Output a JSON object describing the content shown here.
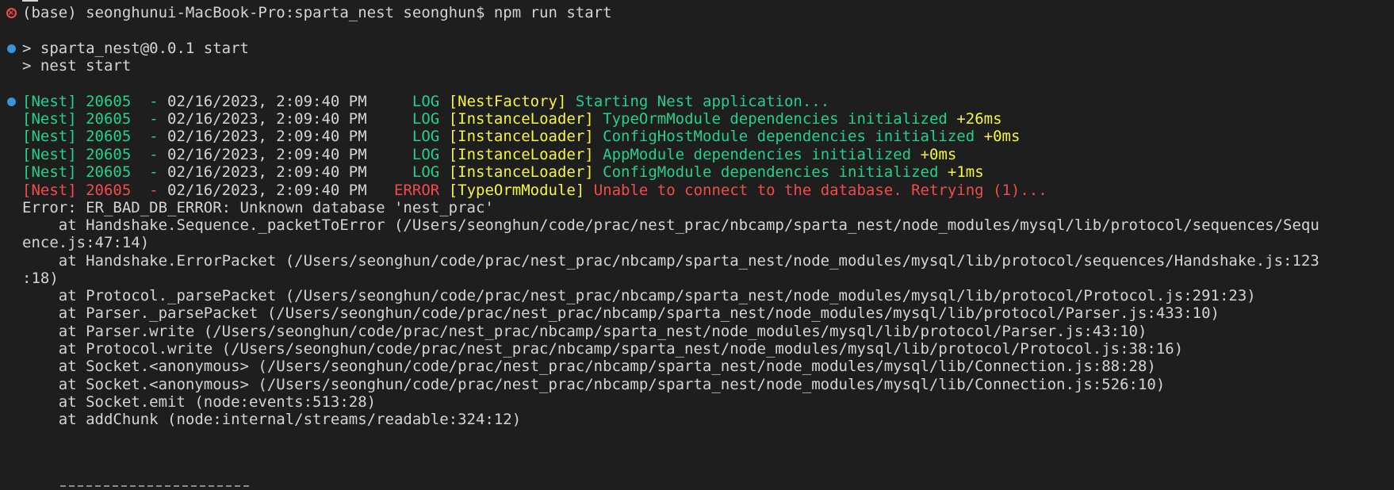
{
  "terminal": {
    "prompt_line": {
      "text": "(base) seonghunui-MacBook-Pro:sparta_nest seonghun$ npm run start"
    },
    "script_lines": [
      "> sparta_nest@0.0.1 start",
      "> nest start"
    ],
    "log_entries": [
      {
        "prefix": "[Nest] 20605  - ",
        "timestamp": "02/16/2023, 2:09:40 PM",
        "level": "    LOG",
        "context": "[NestFactory]",
        "message": "Starting Nest application...",
        "delta": ""
      },
      {
        "prefix": "[Nest] 20605  - ",
        "timestamp": "02/16/2023, 2:09:40 PM",
        "level": "    LOG",
        "context": "[InstanceLoader]",
        "message": "TypeOrmModule dependencies initialized",
        "delta": "+26ms"
      },
      {
        "prefix": "[Nest] 20605  - ",
        "timestamp": "02/16/2023, 2:09:40 PM",
        "level": "    LOG",
        "context": "[InstanceLoader]",
        "message": "ConfigHostModule dependencies initialized",
        "delta": "+0ms"
      },
      {
        "prefix": "[Nest] 20605  - ",
        "timestamp": "02/16/2023, 2:09:40 PM",
        "level": "    LOG",
        "context": "[InstanceLoader]",
        "message": "AppModule dependencies initialized",
        "delta": "+0ms"
      },
      {
        "prefix": "[Nest] 20605  - ",
        "timestamp": "02/16/2023, 2:09:40 PM",
        "level": "    LOG",
        "context": "[InstanceLoader]",
        "message": "ConfigModule dependencies initialized",
        "delta": "+1ms"
      },
      {
        "prefix": "[Nest] 20605  - ",
        "timestamp": "02/16/2023, 2:09:40 PM",
        "level": "  ERROR",
        "context": "[TypeOrmModule]",
        "message": "Unable to connect to the database. Retrying (1)...",
        "delta": ""
      }
    ],
    "stack": [
      "Error: ER_BAD_DB_ERROR: Unknown database 'nest_prac'",
      "    at Handshake.Sequence._packetToError (/Users/seonghun/code/prac/nest_prac/nbcamp/sparta_nest/node_modules/mysql/lib/protocol/sequences/Sequ",
      "ence.js:47:14)",
      "    at Handshake.ErrorPacket (/Users/seonghun/code/prac/nest_prac/nbcamp/sparta_nest/node_modules/mysql/lib/protocol/sequences/Handshake.js:123",
      ":18)",
      "    at Protocol._parsePacket (/Users/seonghun/code/prac/nest_prac/nbcamp/sparta_nest/node_modules/mysql/lib/protocol/Protocol.js:291:23)",
      "    at Parser._parsePacket (/Users/seonghun/code/prac/nest_prac/nbcamp/sparta_nest/node_modules/mysql/lib/protocol/Parser.js:433:10)",
      "    at Parser.write (/Users/seonghun/code/prac/nest_prac/nbcamp/sparta_nest/node_modules/mysql/lib/protocol/Parser.js:43:10)",
      "    at Protocol.write (/Users/seonghun/code/prac/nest_prac/nbcamp/sparta_nest/node_modules/mysql/lib/protocol/Protocol.js:38:16)",
      "    at Socket.<anonymous> (/Users/seonghun/code/prac/nest_prac/nbcamp/sparta_nest/node_modules/mysql/lib/Connection.js:88:28)",
      "    at Socket.<anonymous> (/Users/seonghun/code/prac/nest_prac/nbcamp/sparta_nest/node_modules/mysql/lib/Connection.js:526:10)",
      "    at Socket.emit (node:events:513:28)",
      "    at addChunk (node:internal/streams/readable:324:12)"
    ],
    "icons": {
      "error": "error-circle-icon",
      "marker": "command-marker-dot-icon"
    },
    "colors": {
      "background": "#1e1e1e",
      "default": "#d4d4d4",
      "green": "#23d18b",
      "yellow": "#f5f543",
      "red": "#f14c4c",
      "marker": "#3794d8"
    }
  }
}
